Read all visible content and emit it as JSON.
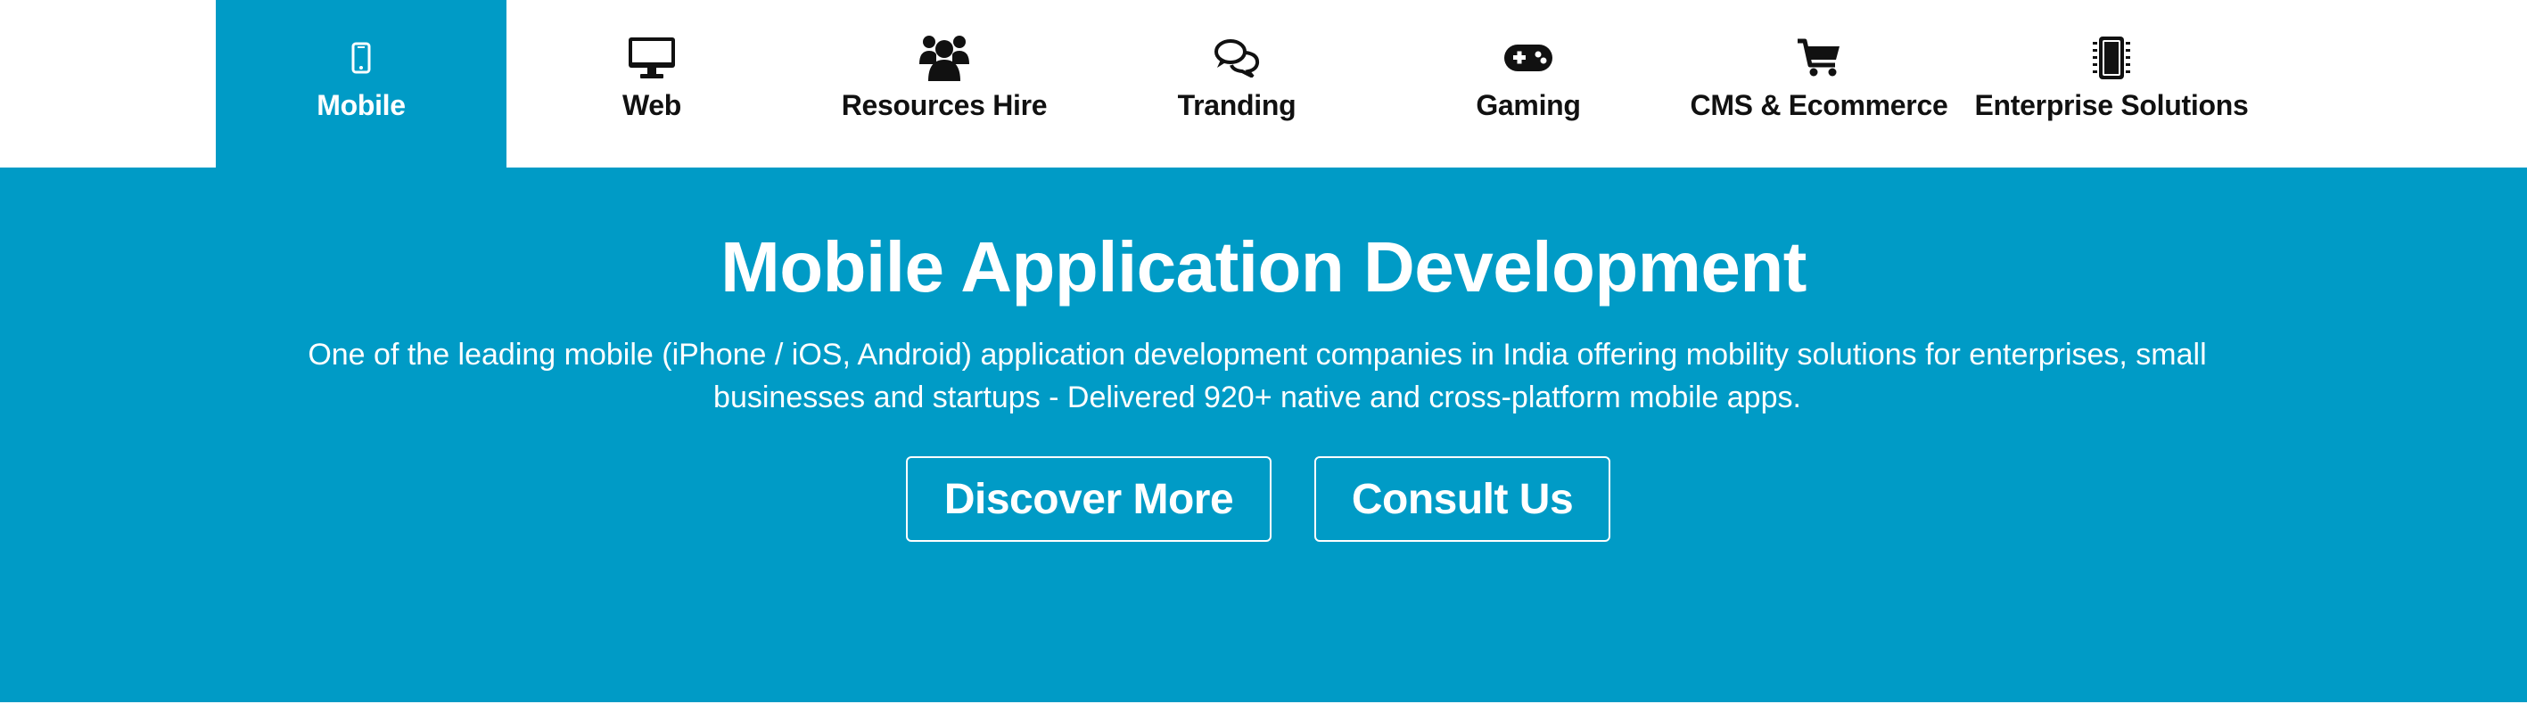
{
  "tabs": [
    {
      "label": "Mobile",
      "icon": "mobile-phone-icon",
      "active": true
    },
    {
      "label": "Web",
      "icon": "desktop-monitor-icon",
      "active": false
    },
    {
      "label": "Resources Hire",
      "icon": "users-group-icon",
      "active": false
    },
    {
      "label": "Tranding",
      "icon": "chat-bubbles-icon",
      "active": false
    },
    {
      "label": "Gaming",
      "icon": "gamepad-icon",
      "active": false
    },
    {
      "label": "CMS & Ecommerce",
      "icon": "shopping-cart-icon",
      "active": false
    },
    {
      "label": "Enterprise Solutions",
      "icon": "chip-icon",
      "active": false
    }
  ],
  "hero": {
    "title": "Mobile Application Development",
    "description": "One of the leading mobile (iPhone / iOS, Android) application development companies in India offering mobility solutions for enterprises, small businesses and startups - Delivered 920+ native and cross-platform mobile apps.",
    "discover_label": "Discover More",
    "consult_label": "Consult Us"
  },
  "colors": {
    "accent": "#009bc6",
    "text_dark": "#111111",
    "text_light": "#ffffff"
  }
}
